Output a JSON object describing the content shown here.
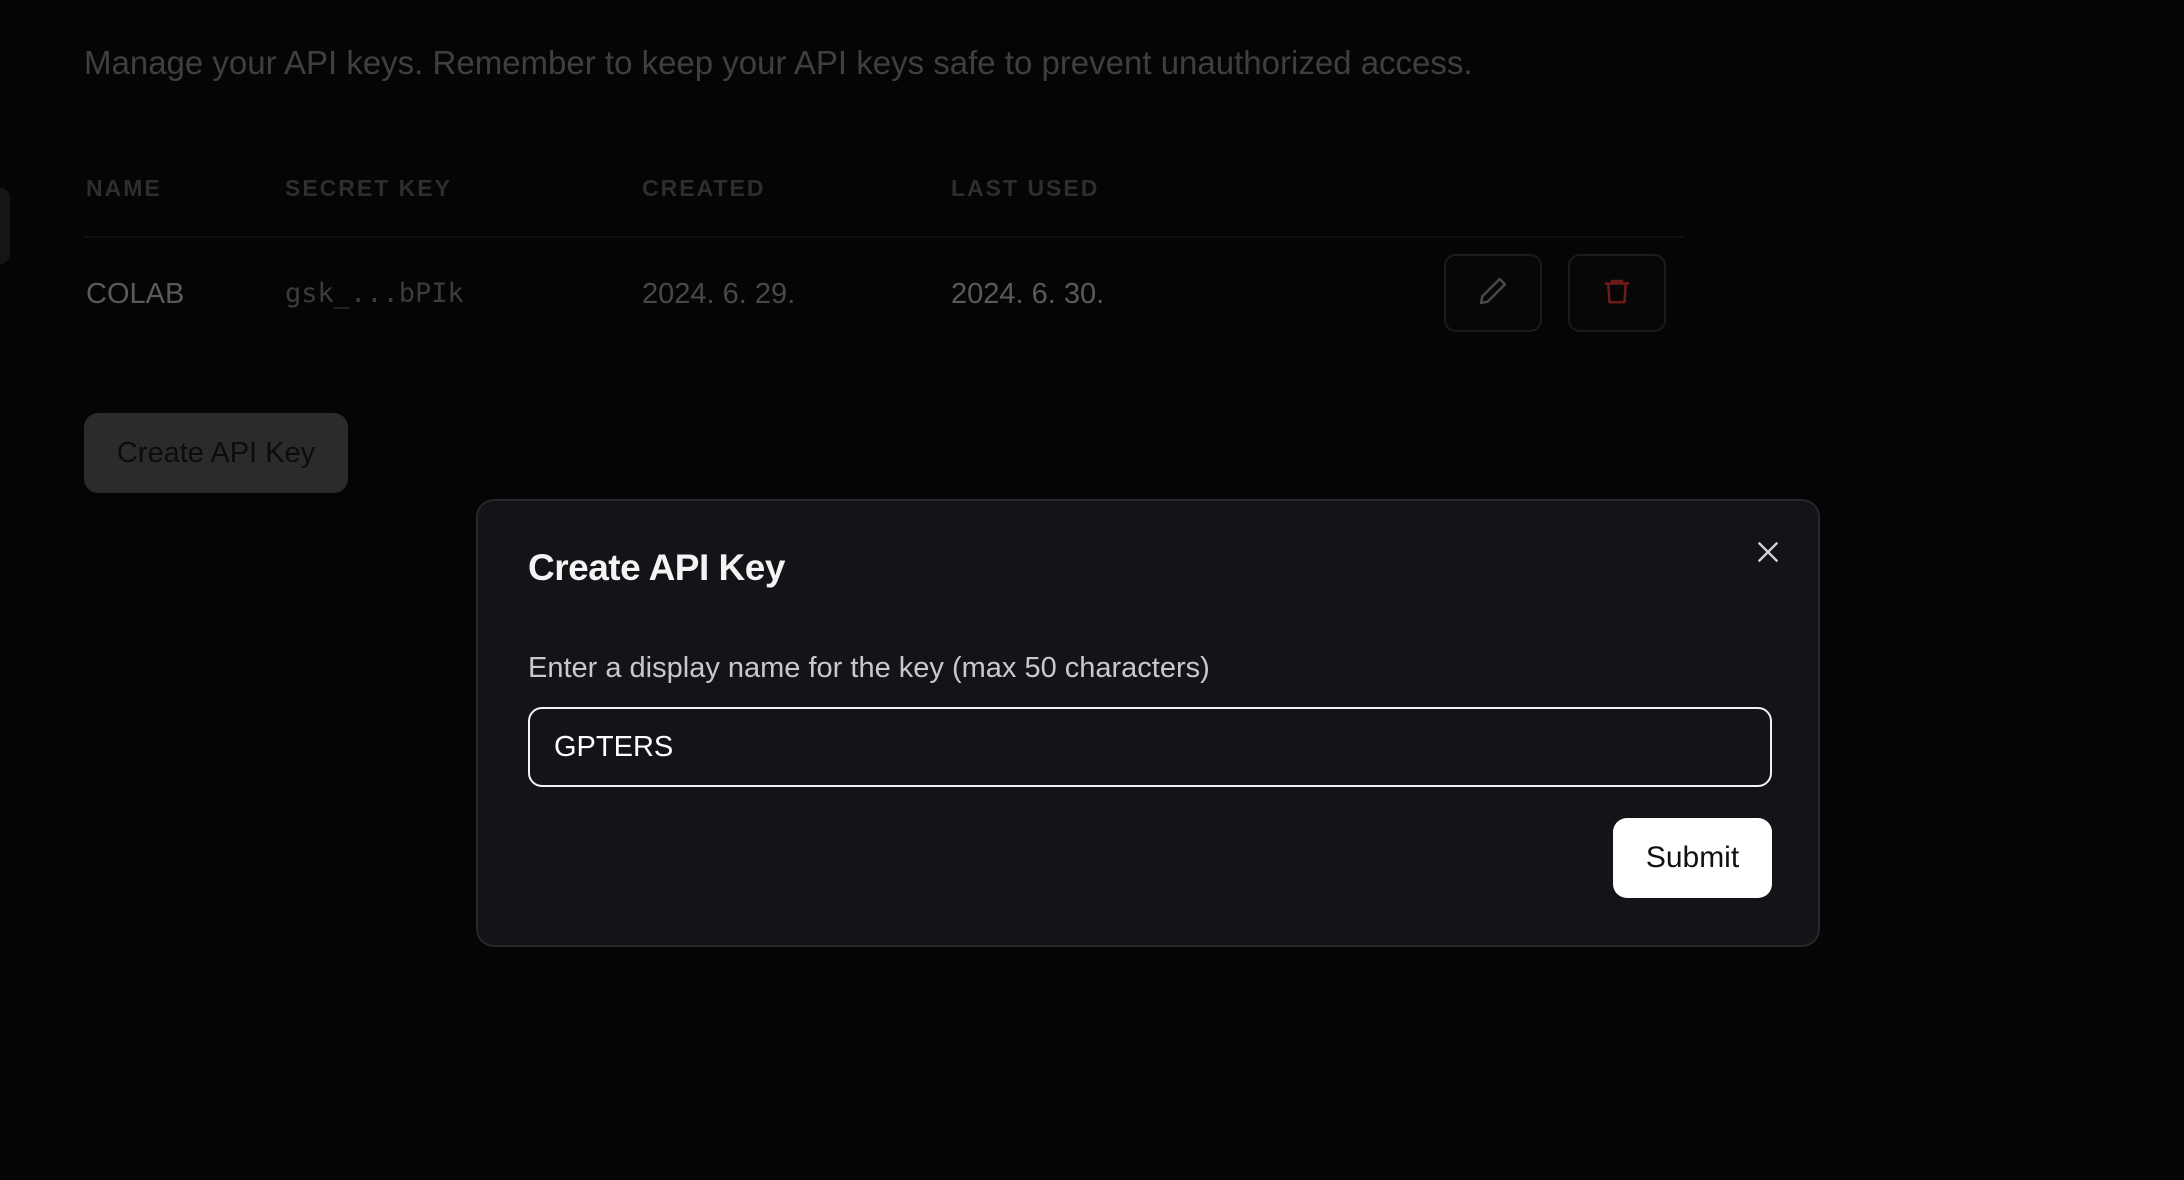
{
  "page": {
    "description": "Manage your API keys. Remember to keep your API keys safe to prevent unauthorized access."
  },
  "table": {
    "headers": {
      "name": "NAME",
      "secret_key": "SECRET KEY",
      "created": "CREATED",
      "last_used": "LAST USED"
    },
    "rows": [
      {
        "name": "COLAB",
        "secret_key": "gsk_...bPIk",
        "created": "2024. 6. 29.",
        "last_used": "2024. 6. 30."
      }
    ],
    "row_actions": {
      "edit_icon": "pencil-icon",
      "delete_icon": "trash-icon",
      "delete_color": "#7a1a1a"
    }
  },
  "create_button": {
    "label": "Create API Key"
  },
  "modal": {
    "title": "Create API Key",
    "close_icon": "close-icon",
    "field_label": "Enter a display name for the key (max 50 characters)",
    "input_value": "GPTERS",
    "submit_label": "Submit"
  },
  "colors": {
    "background": "#050505",
    "modal_background": "#121417",
    "submit_background": "#ffffff"
  }
}
